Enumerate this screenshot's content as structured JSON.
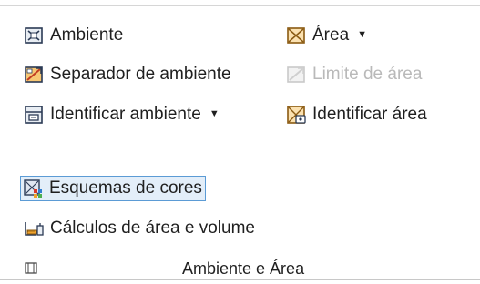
{
  "panel": {
    "title": "Ambiente e Área",
    "commands": {
      "room": {
        "label": "Ambiente",
        "icon": "room-icon"
      },
      "area": {
        "label": "Área",
        "icon": "area-icon",
        "arrow": "▼"
      },
      "room_separator": {
        "label": "Separador de ambiente",
        "icon": "room-separator-icon"
      },
      "area_boundary": {
        "label": "Limite de área",
        "icon": "area-boundary-icon",
        "disabled": true
      },
      "tag_room": {
        "label": "Identificar ambiente",
        "icon": "tag-room-icon",
        "arrow": "▼"
      },
      "tag_area": {
        "label": "Identificar área",
        "icon": "tag-area-icon"
      },
      "color_schemes": {
        "label": "Esquemas de cores",
        "icon": "color-schemes-icon",
        "highlighted": true
      },
      "area_volume": {
        "label": "Cálculos de área e volume",
        "icon": "area-volume-calc-icon"
      }
    }
  },
  "colors": {
    "highlight_border": "#5b9bd5",
    "highlight_fill": "#e3eef9",
    "disabled_text": "#b9b9b9",
    "icon_orange": "#f0a32c"
  }
}
